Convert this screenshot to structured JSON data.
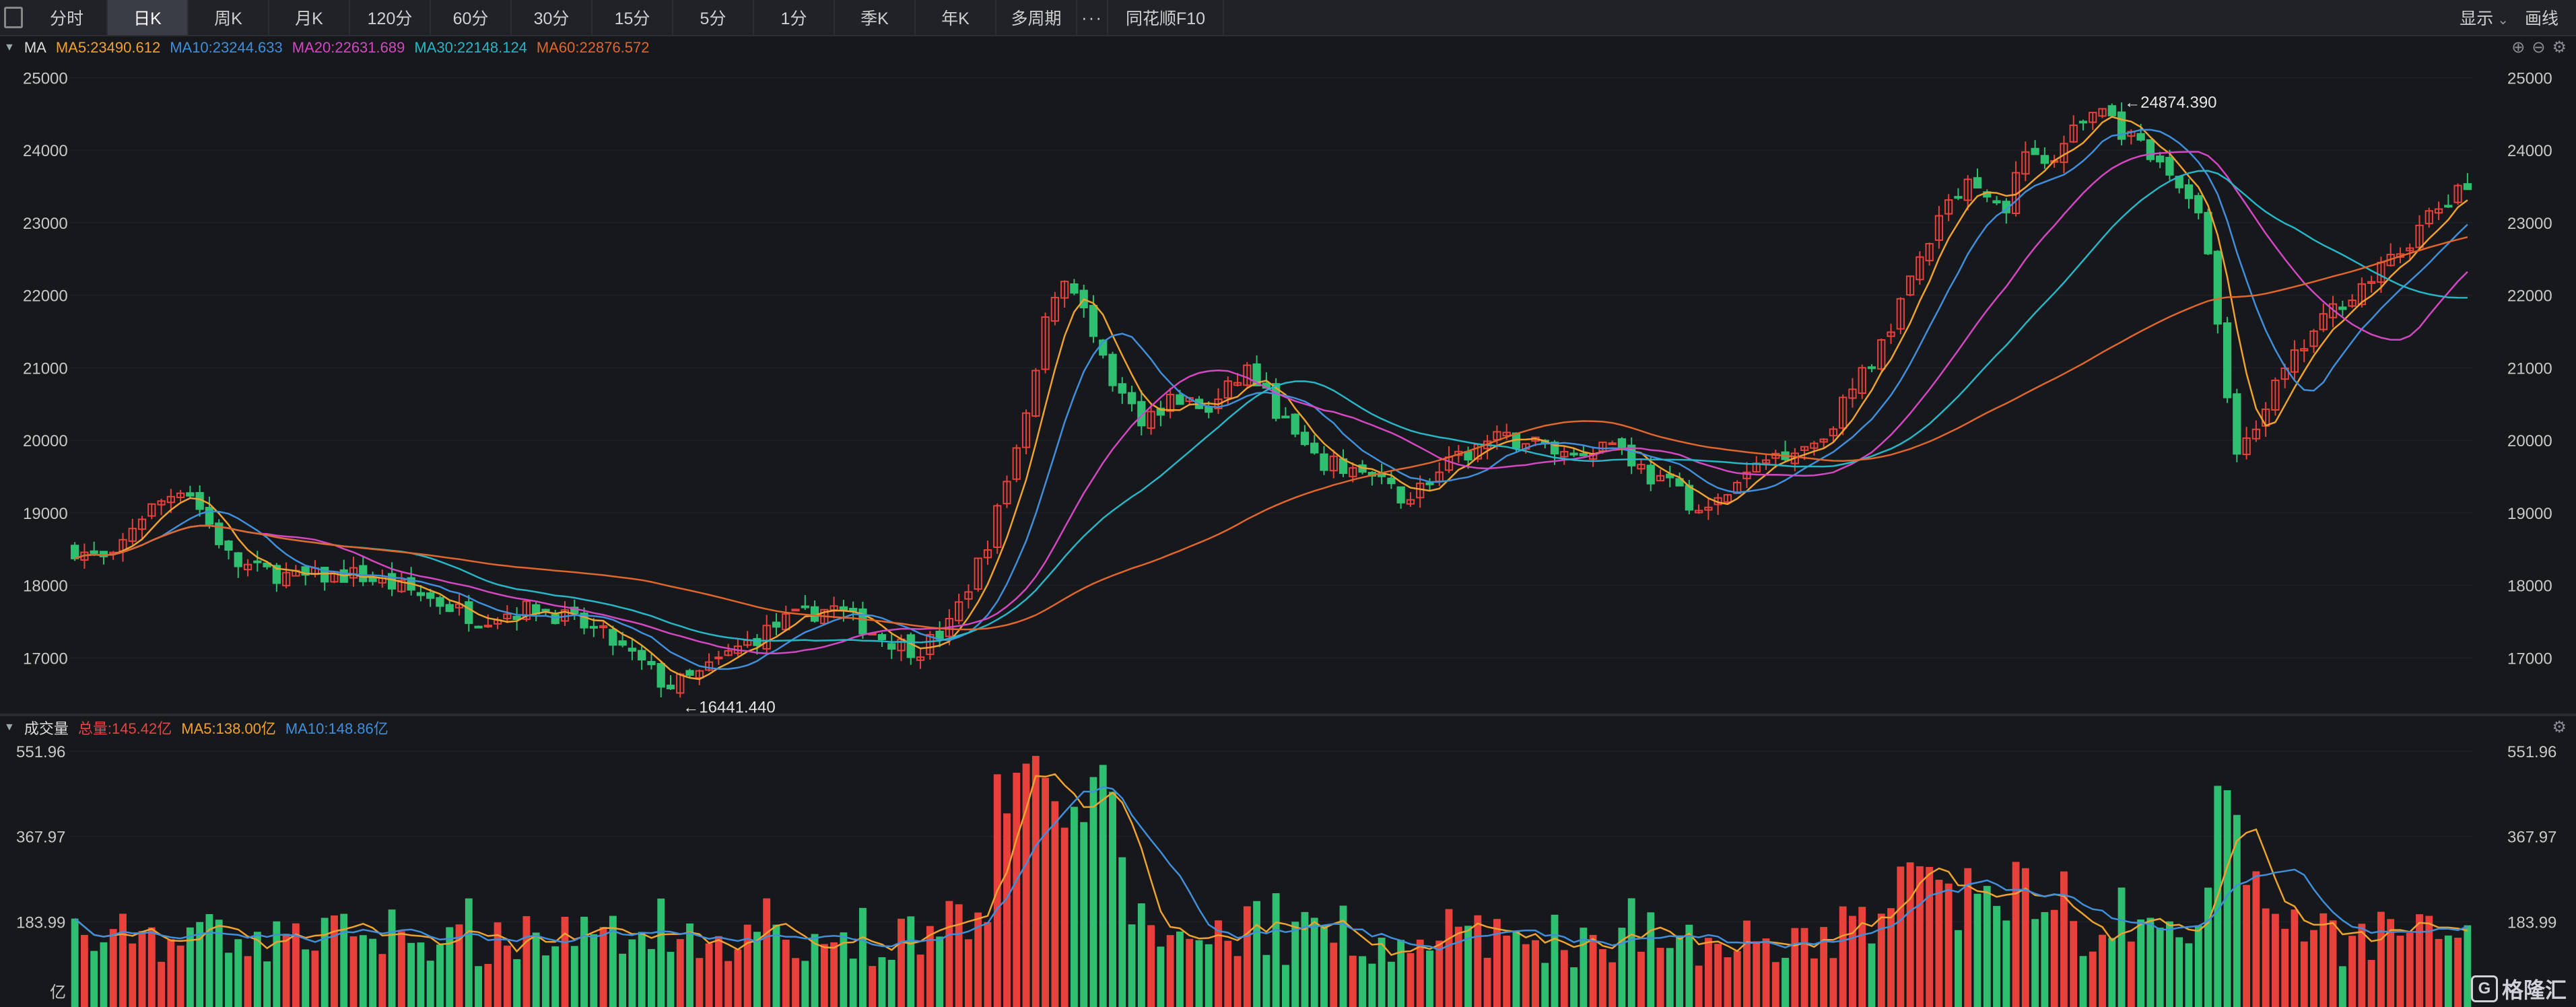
{
  "toolbar": {
    "tabs": [
      "分时",
      "日K",
      "周K",
      "月K",
      "120分",
      "60分",
      "30分",
      "15分",
      "5分",
      "1分",
      "季K",
      "年K",
      "多周期"
    ],
    "active_tab": 1,
    "more": "···",
    "f10": "同花顺F10",
    "display": "显示",
    "draw": "画线"
  },
  "price_panel": {
    "indicator": "MA",
    "legend": [
      {
        "label": "MA5:23490.612",
        "color": "#f0a22e"
      },
      {
        "label": "MA10:23244.633",
        "color": "#3f8fdc"
      },
      {
        "label": "MA20:22631.689",
        "color": "#d447c3"
      },
      {
        "label": "MA30:22148.124",
        "color": "#27b6c7"
      },
      {
        "label": "MA60:22876.572",
        "color": "#e0662c"
      }
    ],
    "ticks": [
      "25000",
      "24000",
      "23000",
      "22000",
      "21000",
      "20000",
      "19000",
      "18000",
      "17000"
    ],
    "high_label": "←24874.390",
    "low_label": "←16441.440"
  },
  "volume_panel": {
    "indicator": "成交量",
    "legend": [
      {
        "label": "总量:145.42亿",
        "color": "#e04747"
      },
      {
        "label": "MA5:138.00亿",
        "color": "#f0a22e"
      },
      {
        "label": "MA10:148.86亿",
        "color": "#3f8fdc"
      }
    ],
    "ticks": [
      "551.96",
      "367.97",
      "183.99"
    ],
    "unit": "亿"
  },
  "watermark": "格隆汇",
  "colors": {
    "up": "#e8403a",
    "down": "#2fbf71",
    "bg": "#17181c"
  },
  "chart_data": {
    "type": "candlestick",
    "price_range": [
      16400,
      25050
    ],
    "volume_max": 551.96,
    "bars": 250,
    "anchors": [
      [
        0,
        18500
      ],
      [
        6,
        18300
      ],
      [
        10,
        18900
      ],
      [
        18,
        19400
      ],
      [
        26,
        18300
      ],
      [
        36,
        18100
      ],
      [
        46,
        18150
      ],
      [
        56,
        17900
      ],
      [
        66,
        17550
      ],
      [
        76,
        17700
      ],
      [
        86,
        17350
      ],
      [
        90,
        17100
      ],
      [
        94,
        16850
      ],
      [
        97,
        16600
      ],
      [
        102,
        16750
      ],
      [
        108,
        17100
      ],
      [
        116,
        17500
      ],
      [
        124,
        17700
      ],
      [
        132,
        17300
      ],
      [
        138,
        17100
      ],
      [
        143,
        17400
      ],
      [
        147,
        18100
      ],
      [
        150,
        18700
      ],
      [
        153,
        19500
      ],
      [
        156,
        20300
      ],
      [
        158,
        21200
      ],
      [
        160,
        22000
      ],
      [
        163,
        22300
      ],
      [
        166,
        21600
      ],
      [
        170,
        20700
      ],
      [
        175,
        20300
      ],
      [
        180,
        20600
      ],
      [
        186,
        20400
      ],
      [
        192,
        21000
      ],
      [
        197,
        20400
      ],
      [
        203,
        19700
      ],
      [
        210,
        19600
      ],
      [
        218,
        19200
      ],
      [
        226,
        19700
      ],
      [
        232,
        20000
      ],
      [
        238,
        20000
      ],
      [
        245,
        19800
      ],
      [
        252,
        20000
      ],
      [
        258,
        19500
      ],
      [
        263,
        19300
      ],
      [
        267,
        18950
      ],
      [
        271,
        19300
      ],
      [
        278,
        19800
      ],
      [
        286,
        20000
      ],
      [
        292,
        20800
      ],
      [
        296,
        21300
      ],
      [
        300,
        22100
      ],
      [
        304,
        22800
      ],
      [
        308,
        23400
      ],
      [
        312,
        23600
      ],
      [
        316,
        23100
      ],
      [
        320,
        24100
      ],
      [
        324,
        23700
      ],
      [
        328,
        24350
      ],
      [
        332,
        24600
      ],
      [
        336,
        24200
      ],
      [
        340,
        23900
      ],
      [
        344,
        23600
      ],
      [
        348,
        23200
      ],
      [
        350,
        22300
      ],
      [
        352,
        21000
      ],
      [
        354,
        19800
      ],
      [
        357,
        20200
      ],
      [
        361,
        20800
      ],
      [
        366,
        21400
      ],
      [
        371,
        21900
      ],
      [
        376,
        22200
      ],
      [
        381,
        22600
      ],
      [
        386,
        23100
      ],
      [
        392,
        23500
      ]
    ],
    "ma_periods": [
      5,
      10,
      20,
      30,
      60
    ]
  }
}
